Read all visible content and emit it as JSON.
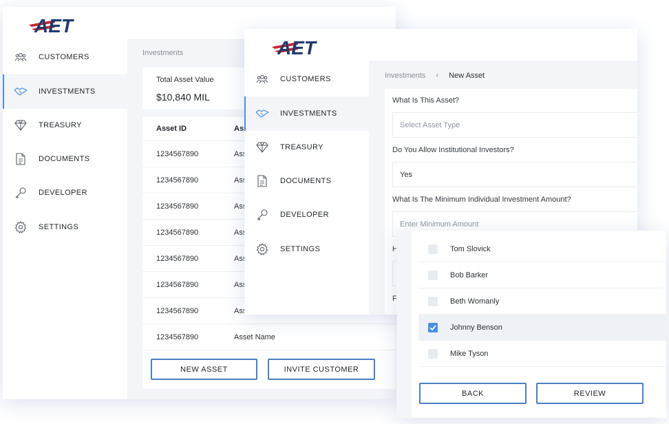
{
  "brand": {
    "logo_text": "AET",
    "logo_red": "#c8262f",
    "logo_navy": "#1f3a6e"
  },
  "accent": "#4a90e2",
  "nav": [
    {
      "label": "CUSTOMERS",
      "icon": "customers-icon"
    },
    {
      "label": "INVESTMENTS",
      "icon": "handshake-icon"
    },
    {
      "label": "TREASURY",
      "icon": "diamond-icon"
    },
    {
      "label": "DOCUMENTS",
      "icon": "document-icon"
    },
    {
      "label": "DEVELOPER",
      "icon": "key-icon"
    },
    {
      "label": "SETTINGS",
      "icon": "gear-icon"
    }
  ],
  "window1": {
    "breadcrumb": "Investments",
    "total_label": "Total Asset Value",
    "total_value": "$10,840 MIL",
    "table": {
      "headers": [
        "Asset ID",
        "Asset Name"
      ],
      "rows": [
        [
          "1234567890",
          "Asset Name"
        ],
        [
          "1234567890",
          "Asset Name"
        ],
        [
          "1234567890",
          "Asset Name"
        ],
        [
          "1234567890",
          "Asset Name"
        ],
        [
          "1234567890",
          "Asset Name"
        ],
        [
          "1234567890",
          "Asset Name"
        ],
        [
          "1234567890",
          "Asset Name"
        ],
        [
          "1234567890",
          "Asset Name"
        ]
      ]
    },
    "new_asset_label": "NEW ASSET",
    "invite_label": "INVITE CUSTOMER"
  },
  "window2": {
    "breadcrumb_root": "Investments",
    "breadcrumb_current": "New Asset",
    "q1": "What Is This Asset?",
    "q1_placeholder": "Select Asset Type",
    "q2": "Do You Allow Institutional Investors?",
    "q2_value": "Yes",
    "q3": "What Is The Minimum Individual Investment Amount?",
    "q3_placeholder": "Enter Minimum Amount",
    "q4_fragment": "H",
    "q5_fragment": "F"
  },
  "window3": {
    "investors": [
      {
        "name": "Tom Slovick",
        "checked": false
      },
      {
        "name": "Bob Barker",
        "checked": false
      },
      {
        "name": "Beth Womanly",
        "checked": false
      },
      {
        "name": "Johnny Benson",
        "checked": true
      },
      {
        "name": "Mike Tyson",
        "checked": false
      }
    ],
    "back_label": "BACK",
    "review_label": "REVIEW"
  }
}
